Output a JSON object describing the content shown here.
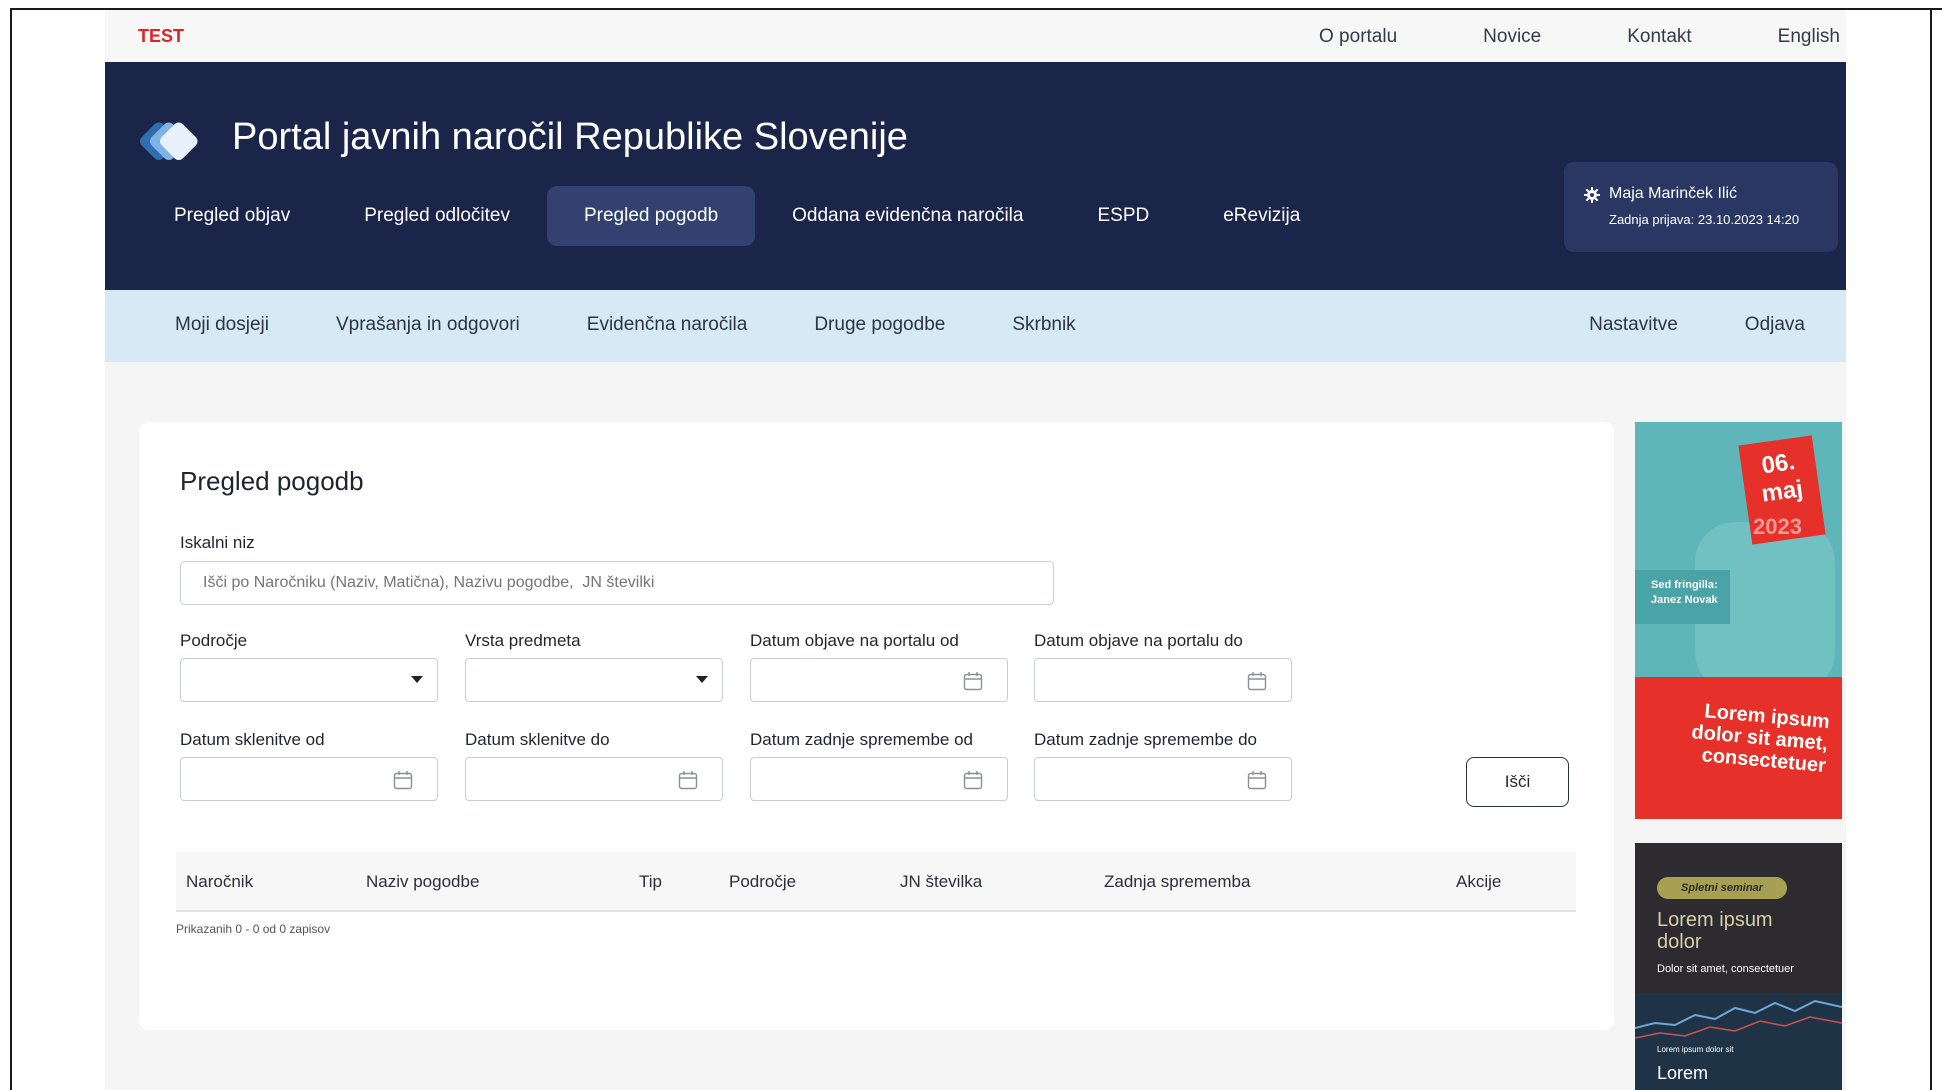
{
  "util": {
    "env": "TEST",
    "links": [
      "O portalu",
      "Novice",
      "Kontakt",
      "English"
    ]
  },
  "header": {
    "title": "Portal javnih naročil Republike Slovenije",
    "nav": [
      "Pregled objav",
      "Pregled odločitev",
      "Pregled pogodb",
      "Oddana evidenčna naročila",
      "ESPD",
      "eRevizija"
    ],
    "active_nav": "Pregled pogodb",
    "user": {
      "name": "Maja Marinček Ilić",
      "last_login": "Zadnja prijava: 23.10.2023 14:20"
    }
  },
  "subnav": {
    "left": [
      "Moji dosjeji",
      "Vprašanja in odgovori",
      "Evidenčna naročila",
      "Druge pogodbe",
      "Skrbnik"
    ],
    "right": [
      "Nastavitve",
      "Odjava"
    ]
  },
  "form": {
    "title": "Pregled pogodb",
    "search_label": "Iskalni niz",
    "search_placeholder": "Išči po Naročniku (Naziv, Matična), Nazivu pogodbe,  JN številki",
    "area_label": "Področje",
    "type_label": "Vrsta predmeta",
    "pub_from_label": "Datum objave na portalu od",
    "pub_to_label": "Datum objave na portalu do",
    "sign_from_label": "Datum sklenitve od",
    "sign_to_label": "Datum sklenitve do",
    "change_from_label": "Datum zadnje spremembe od",
    "change_to_label": "Datum zadnje spremembe do",
    "search_button": "Išči"
  },
  "table": {
    "columns": [
      "Naročnik",
      "Naziv pogodbe",
      "Tip",
      "Področje",
      "JN številka",
      "Zadnja sprememba",
      "Akcije"
    ],
    "rows": [],
    "count_text": "Prikazanih 0 - 0 od 0 zapisov"
  },
  "banners": {
    "event": {
      "day": "06.",
      "month": "maj",
      "year": "2023",
      "speaker": "Sed fringilla: Janez Novak",
      "headline": "Lorem ipsum dolor sit amet, consectetuer"
    },
    "webinar": {
      "tag": "Spletni seminar",
      "title": "Lorem ipsum dolor",
      "subtitle": "Dolor sit amet, consectetuer",
      "bottom_small": "Lorem ipsum dolor sit",
      "bottom_title": "Lorem"
    }
  },
  "colors": {
    "header_bg": "#1b2449",
    "subnav_bg": "#d6eaf6",
    "test_red": "#d8262d",
    "banner_red": "#e5312a",
    "banner_teal": "#5fb6b8"
  }
}
